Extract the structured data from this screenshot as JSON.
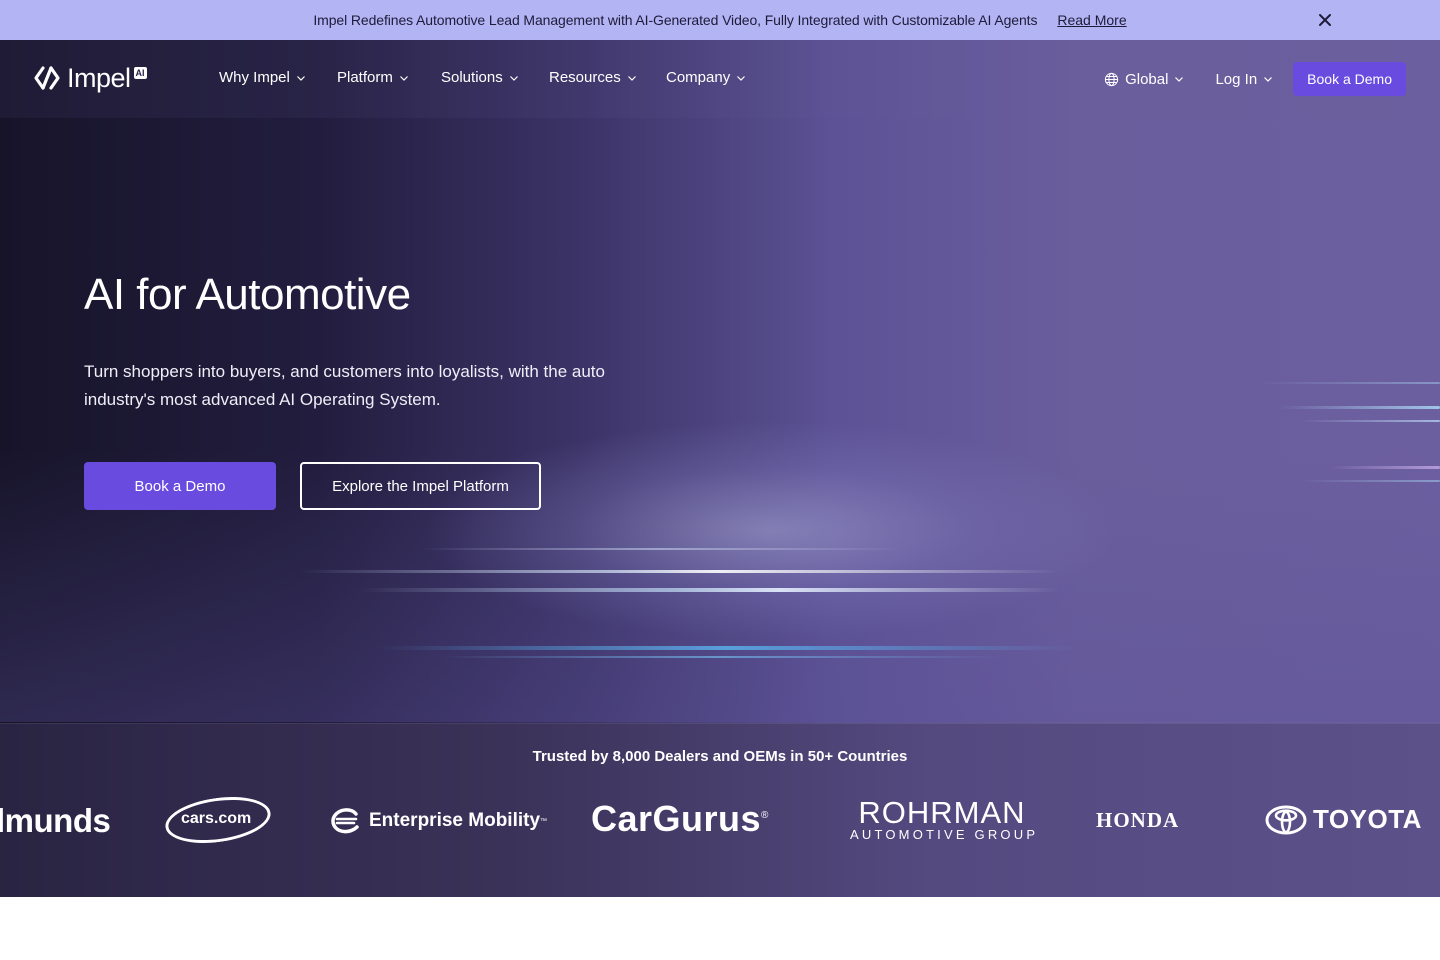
{
  "announcement": {
    "text": "Impel Redefines Automotive Lead Management with AI-Generated Video, Fully Integrated with Customizable AI Agents",
    "link_label": "Read More",
    "close_icon": "close-icon",
    "background": "#b3b4f3"
  },
  "nav": {
    "logo_text": "Impel",
    "logo_badge": "AI",
    "menu": [
      {
        "label": "Why Impel"
      },
      {
        "label": "Platform"
      },
      {
        "label": "Solutions"
      },
      {
        "label": "Resources"
      },
      {
        "label": "Company"
      }
    ],
    "region_label": "Global",
    "login_label": "Log In",
    "demo_label": "Book a Demo"
  },
  "hero": {
    "title": "AI for Automotive",
    "subtitle": "Turn shoppers into buyers, and customers into loyalists, with the auto industry's most advanced AI Operating System.",
    "primary_cta": "Book a Demo",
    "secondary_cta": "Explore the Impel Platform"
  },
  "trusted": {
    "title": "Trusted by 8,000 Dealers and OEMs in 50+ Countries",
    "logos": {
      "edmunds": "lmunds",
      "cars": "cars.com",
      "enterprise": "Enterprise Mobility",
      "enterprise_tm": "™",
      "cargurus": "CarGurus",
      "cargurus_reg": "®",
      "rohrman_1": "ROHRMAN",
      "rohrman_2": "AUTOMOTIVE GROUP",
      "honda": "HONDA",
      "toyota": "TOYOTA"
    }
  },
  "colors": {
    "accent": "#6a4be0",
    "hero_dark": "#17142a",
    "hero_light": "#6c5fa0"
  }
}
